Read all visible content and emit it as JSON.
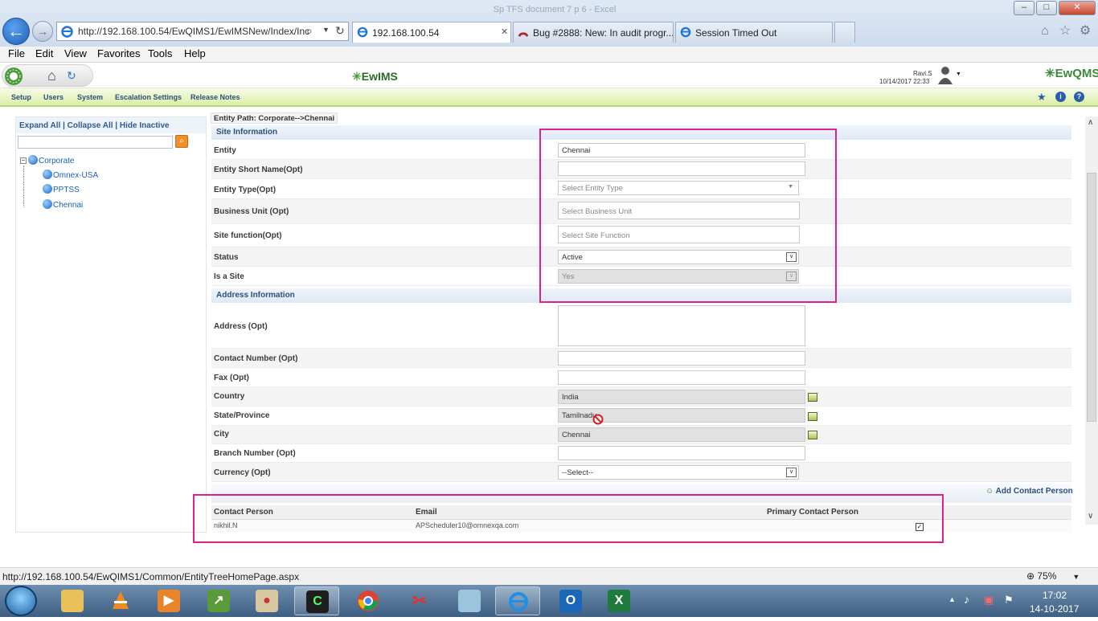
{
  "browser": {
    "window_title": "Sp TFS document 7 p 6 - Excel",
    "address": "http://192.168.100.54/EwQIMS1/EwIMSNew/Index/Inc",
    "tabs": [
      {
        "label": "192.168.100.54",
        "active": true
      },
      {
        "label": "Bug #2888: New: In audit progr...",
        "active": false
      },
      {
        "label": "Session Timed Out",
        "active": false
      }
    ],
    "minimize": "–",
    "maximize": "□",
    "close": "✕",
    "close_tab": "✕"
  },
  "menu": [
    "File",
    "Edit",
    "View",
    "Favorites",
    "Tools",
    "Help"
  ],
  "app": {
    "logo": "EwIMS",
    "user_name": "Ravi.S",
    "user_datetime": "10/14/2017 22:33",
    "qms_logo": "EwQMS",
    "nav": [
      "Setup",
      "Users",
      "System",
      "Escalation Settings",
      "Release Notes"
    ]
  },
  "tree": {
    "links": "Expand All | Collapse All | Hide Inactive",
    "root": "Corporate",
    "children": [
      "Omnex-USA",
      "PPTSS",
      "Chennai"
    ]
  },
  "form": {
    "entity_path": "Entity Path: Corporate-->Chennai",
    "site_section": "Site Information",
    "address_section": "Address Information",
    "fields": {
      "entity": {
        "label": "Entity",
        "value": "Chennai"
      },
      "short_name": {
        "label": "Entity Short Name(Opt)",
        "value": ""
      },
      "entity_type": {
        "label": "Entity Type(Opt)",
        "placeholder": "Select Entity Type"
      },
      "business_unit": {
        "label": "Business Unit (Opt)",
        "placeholder": "Select Business Unit"
      },
      "site_function": {
        "label": "Site function(Opt)",
        "placeholder": "Select Site Function"
      },
      "status": {
        "label": "Status",
        "value": "Active"
      },
      "is_site": {
        "label": "Is a Site",
        "value": "Yes"
      },
      "address": {
        "label": "Address (Opt)",
        "value": ""
      },
      "contact_number": {
        "label": "Contact Number (Opt)",
        "value": ""
      },
      "fax": {
        "label": "Fax (Opt)",
        "value": ""
      },
      "country": {
        "label": "Country",
        "value": "India"
      },
      "state": {
        "label": "State/Province",
        "value": "Tamilnadu"
      },
      "city": {
        "label": "City",
        "value": "Chennai"
      },
      "branch": {
        "label": "Branch Number (Opt)",
        "value": ""
      },
      "currency": {
        "label": "Currency (Opt)",
        "value": "--Select--"
      }
    },
    "add_contact": "Add Contact Person",
    "contacts": {
      "headers": [
        "Contact Person",
        "Email",
        "Primary Contact Person"
      ],
      "rows": [
        {
          "person": "nikhil.N",
          "email": "APScheduler10@omnexqa.com",
          "primary": "✓"
        }
      ]
    }
  },
  "status": {
    "url": "http://192.168.100.54/EwQIMS1/Common/EntityTreeHomePage.aspx",
    "zoom": "75%"
  },
  "taskbar": {
    "time": "17:02",
    "date": "14-10-2017"
  },
  "colors": {
    "highlight": "#e0218a",
    "nav_bg": "#dcefa8",
    "link": "#2f5b94"
  }
}
